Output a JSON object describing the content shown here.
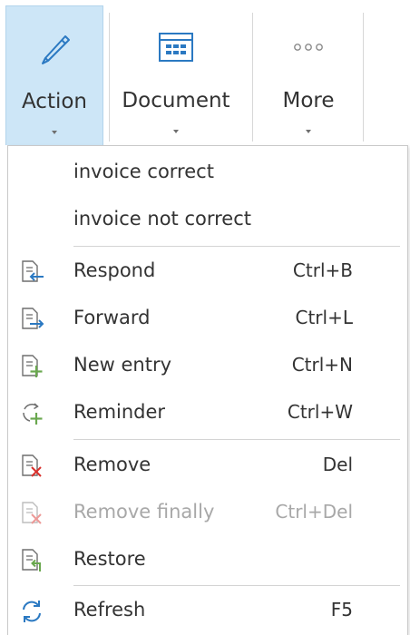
{
  "ribbon": {
    "buttons": [
      {
        "label": "Action",
        "icon": "pencil-icon",
        "active": true
      },
      {
        "label": "Document",
        "icon": "document-table-icon",
        "active": false
      },
      {
        "label": "More",
        "icon": "ellipsis-icon",
        "active": false
      }
    ]
  },
  "menu": {
    "quick_items": [
      {
        "label": "invoice correct"
      },
      {
        "label": "invoice not correct"
      }
    ],
    "items": [
      {
        "label": "Respond",
        "shortcut": "Ctrl+B",
        "icon": "respond-icon",
        "enabled": true
      },
      {
        "label": "Forward",
        "shortcut": "Ctrl+L",
        "icon": "forward-icon",
        "enabled": true
      },
      {
        "label": "New entry",
        "shortcut": "Ctrl+N",
        "icon": "new-entry-icon",
        "enabled": true
      },
      {
        "label": "Reminder",
        "shortcut": "Ctrl+W",
        "icon": "reminder-icon",
        "enabled": true
      },
      {
        "label": "Remove",
        "shortcut": "Del",
        "icon": "remove-icon",
        "enabled": true
      },
      {
        "label": "Remove finally",
        "shortcut": "Ctrl+Del",
        "icon": "remove-finally-icon",
        "enabled": false
      },
      {
        "label": "Restore",
        "shortcut": "",
        "icon": "restore-icon",
        "enabled": true
      },
      {
        "label": "Refresh",
        "shortcut": "F5",
        "icon": "refresh-icon",
        "enabled": true
      }
    ]
  },
  "colors": {
    "accent_blue": "#2b79c2",
    "active_tab_bg": "#cde6f7",
    "add_green": "#6aa84f",
    "remove_red": "#d9302c",
    "text": "#333333",
    "disabled_text": "#a8a8a8"
  }
}
